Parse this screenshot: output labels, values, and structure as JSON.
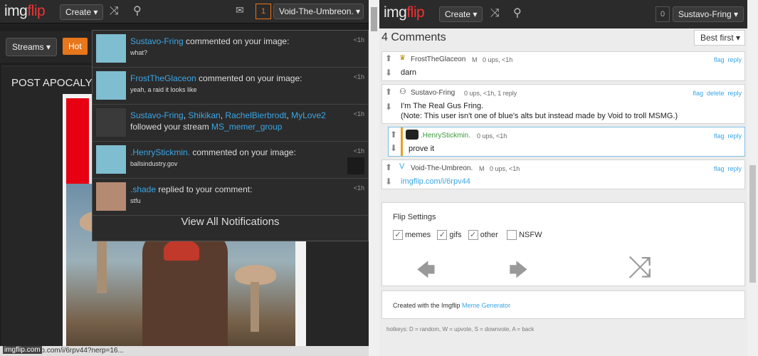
{
  "left": {
    "logo_a": "img",
    "logo_b": "flip",
    "create_label": "Create ▾",
    "notif_count": "1",
    "user_label": "Void-The-Umbreon. ▾",
    "streams_label": "Streams ▾",
    "hot_label": "Hot",
    "post_title": "POST APOCALY",
    "status_url": "https://imgflip.com/i/6rpv44?nerp=16...",
    "watermark": "imgflip.com"
  },
  "notifications": {
    "items": [
      {
        "user": "Sustavo-Fring",
        "action": " commented on your image:",
        "detail": "what?",
        "time": "<1h"
      },
      {
        "user": "FrostTheGlaceon",
        "action": " commented on your image:",
        "detail": "yeah, a raid it looks like",
        "time": "<1h"
      },
      {
        "users": [
          "Sustavo-Fring",
          ", ",
          "Shikikan",
          ", ",
          "RachelBierbrodt",
          ", ",
          "MyLove2"
        ],
        "action": "followed your stream ",
        "stream": "MS_memer_group",
        "time": "<1h"
      },
      {
        "user": ".HenryStickmin.",
        "action": " commented on your image:",
        "detail": "ballsindustry.gov",
        "time": "<1h"
      },
      {
        "user": ".shade",
        "action": " replied to your comment:",
        "detail": "stfu",
        "time": "<1h"
      }
    ],
    "view_all": "View All Notifications"
  },
  "right": {
    "logo_a": "img",
    "logo_b": "flip",
    "create_label": "Create ▾",
    "notif_count": "0",
    "user_label": "Sustavo-Fring ▾",
    "comments_count": "4 Comments",
    "sort_label": "Best first ▾",
    "comments": [
      {
        "name": "FrostTheGlaceon",
        "meta": "M   0 ups, <1h",
        "actions": "flag  reply",
        "text": "darn"
      },
      {
        "name": "Sustavo-Fring",
        "meta": "0 ups, <1h, 1 reply",
        "actions": "flag  delete  reply",
        "text1": "I'm The Real Gus Fring.",
        "text2": "(Note: This user isn't one of blue's alts but instead made by Void to troll MSMG.)"
      },
      {
        "name": ".HenryStickmin.",
        "meta": "0 ups, <1h",
        "actions": "flag  reply",
        "text": "prove it"
      },
      {
        "name": "Void-The-Umbreon.",
        "meta": "M   0 ups, <1h",
        "actions": "flag  reply",
        "text": "imgflip.com/i/6rpv44"
      }
    ],
    "flip_settings": "Flip Settings",
    "opts": [
      "memes",
      "gifs",
      "other",
      "NSFW"
    ],
    "created_prefix": "Created with the Imgflip ",
    "created_link": "Meme Generator",
    "hotkeys": "hotkeys: D = random, W = upvote, S = downvote, A = back"
  }
}
